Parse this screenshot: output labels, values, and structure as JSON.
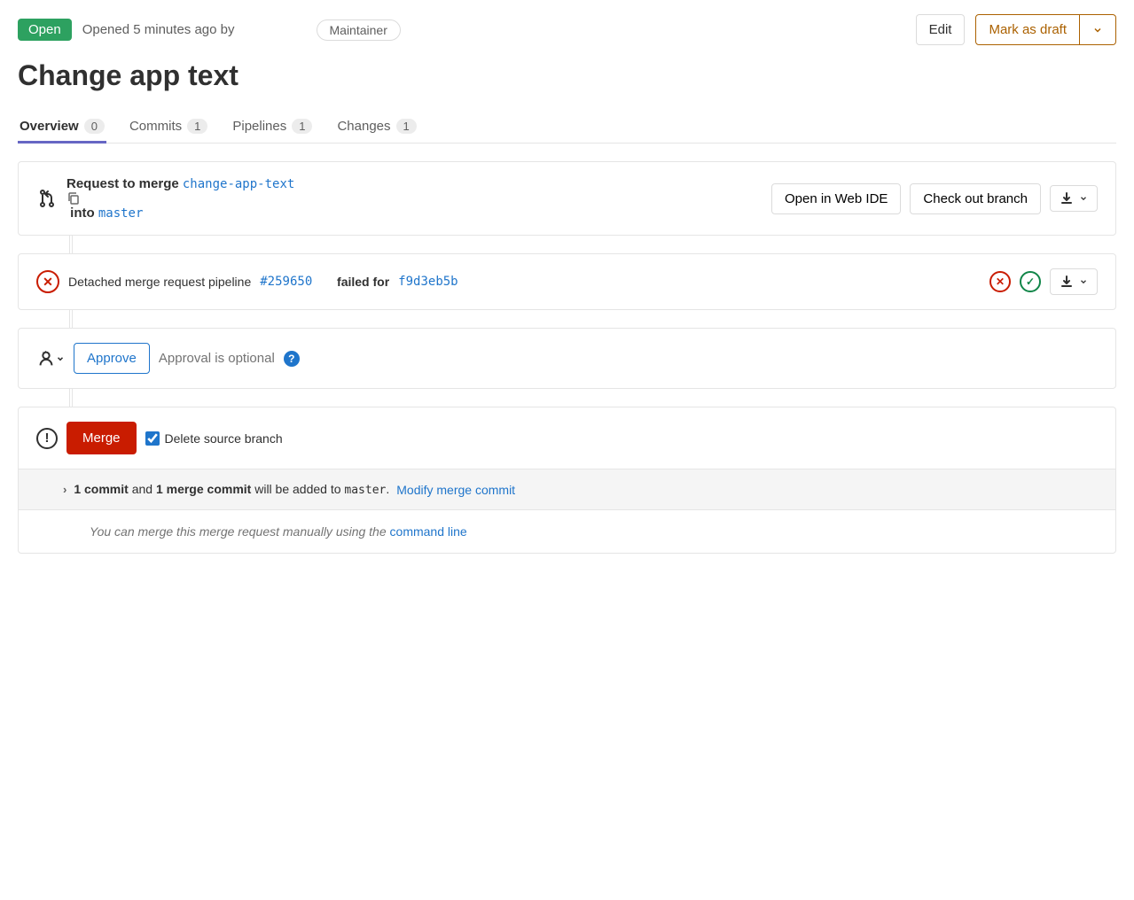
{
  "header": {
    "status_badge": "Open",
    "opened_text": "Opened 5 minutes ago by",
    "role_badge": "Maintainer",
    "edit_button": "Edit",
    "draft_button": "Mark as draft"
  },
  "title": "Change app text",
  "tabs": [
    {
      "label": "Overview",
      "count": "0",
      "active": true
    },
    {
      "label": "Commits",
      "count": "1",
      "active": false
    },
    {
      "label": "Pipelines",
      "count": "1",
      "active": false
    },
    {
      "label": "Changes",
      "count": "1",
      "active": false
    }
  ],
  "merge_request": {
    "prefix": "Request to merge",
    "source_branch": "change-app-text",
    "into": "into",
    "target_branch": "master",
    "open_ide": "Open in Web IDE",
    "checkout": "Check out branch"
  },
  "pipeline": {
    "label": "Detached merge request pipeline",
    "id": "#259650",
    "failed_for": "failed for",
    "commit": "f9d3eb5b"
  },
  "approval": {
    "approve_button": "Approve",
    "optional_text": "Approval is optional"
  },
  "merge": {
    "button": "Merge",
    "delete_branch_label": "Delete source branch",
    "commit_count": "1 commit",
    "and": "and",
    "merge_commit": "1 merge commit",
    "added_to": "will be added to",
    "target_branch": "master",
    "modify_link": "Modify merge commit",
    "manual_text": "You can merge this merge request manually using the",
    "command_line": "command line"
  }
}
